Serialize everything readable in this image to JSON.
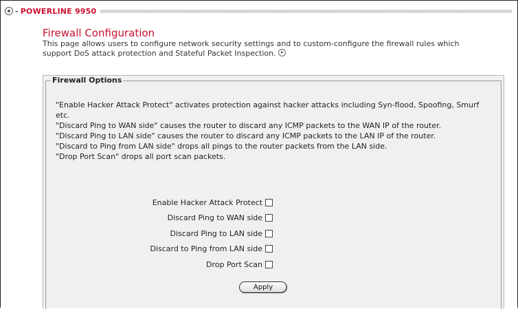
{
  "brand": {
    "name": "POWERLINE 9950"
  },
  "header": {
    "title": "Firewall Configuration",
    "description": "This page allows users to configure network security settings and to custom-configure the firewall rules which support DoS attack protection and Stateful Packet Inspection."
  },
  "panel": {
    "legend": "Firewall Options",
    "help": [
      "\"Enable Hacker Attack Protect\" activates protection against hacker attacks including Syn-flood, Spoofing, Smurf etc.",
      "\"Discard Ping to WAN side\" causes the router to discard any ICMP packets to the WAN IP of the router.",
      "\"Discard Ping to LAN side\"  causes the router  to discard any ICMP packets to the LAN IP of the router.",
      "\"Discard to Ping from LAN side\" drops all pings to the router packets from the LAN side.",
      "\"Drop Port Scan\" drops all port scan packets."
    ],
    "options": [
      {
        "label": "Enable Hacker Attack Protect",
        "checked": false
      },
      {
        "label": "Discard Ping to WAN side",
        "checked": false
      },
      {
        "label": "Discard Ping to LAN side",
        "checked": false
      },
      {
        "label": "Discard to Ping from LAN side",
        "checked": false
      },
      {
        "label": "Drop Port Scan",
        "checked": false
      }
    ],
    "apply_label": "Apply"
  },
  "icons": {
    "brand": "powerline-logo-icon",
    "more": "circle-arrow-right-icon"
  },
  "colors": {
    "accent": "#c8102e",
    "panel_bg": "#f0f0f0"
  }
}
